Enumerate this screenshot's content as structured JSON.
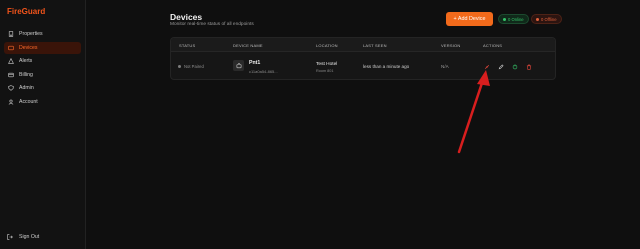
{
  "app": {
    "brand": "FireGuard"
  },
  "sidebar": {
    "items": [
      {
        "label": "Properties",
        "icon": "building-icon",
        "active": false
      },
      {
        "label": "Devices",
        "icon": "devices-icon",
        "active": true
      },
      {
        "label": "Alerts",
        "icon": "alert-icon",
        "active": false
      },
      {
        "label": "Billing",
        "icon": "card-icon",
        "active": false
      },
      {
        "label": "Admin",
        "icon": "shield-icon",
        "active": false
      },
      {
        "label": "Account",
        "icon": "user-icon",
        "active": false
      }
    ],
    "signout_label": "Sign Out"
  },
  "header": {
    "title": "Devices",
    "subtitle": "Monitor real-time status of all endpoints",
    "add_button_label": "+ Add Device",
    "online_badge": "0 Online",
    "offline_badge": "0 Offline"
  },
  "table": {
    "columns": [
      "STATUS",
      "DEVICE NAME",
      "LOCATION",
      "LAST SEEN",
      "VERSION",
      "ACTIONS"
    ],
    "rows": [
      {
        "status": "Not Paired",
        "device_name": "Pnt1",
        "device_id": "c11a0a54-865...",
        "location_name": "Test Hotel",
        "location_room": "Room 801",
        "last_seen": "less than a minute ago",
        "version": "N/A"
      }
    ]
  },
  "colors": {
    "accent": "#f26a1b",
    "brand": "#f2541b",
    "online": "#35c469",
    "offline": "#e0623c",
    "annotation_arrow": "#d81e1e"
  }
}
